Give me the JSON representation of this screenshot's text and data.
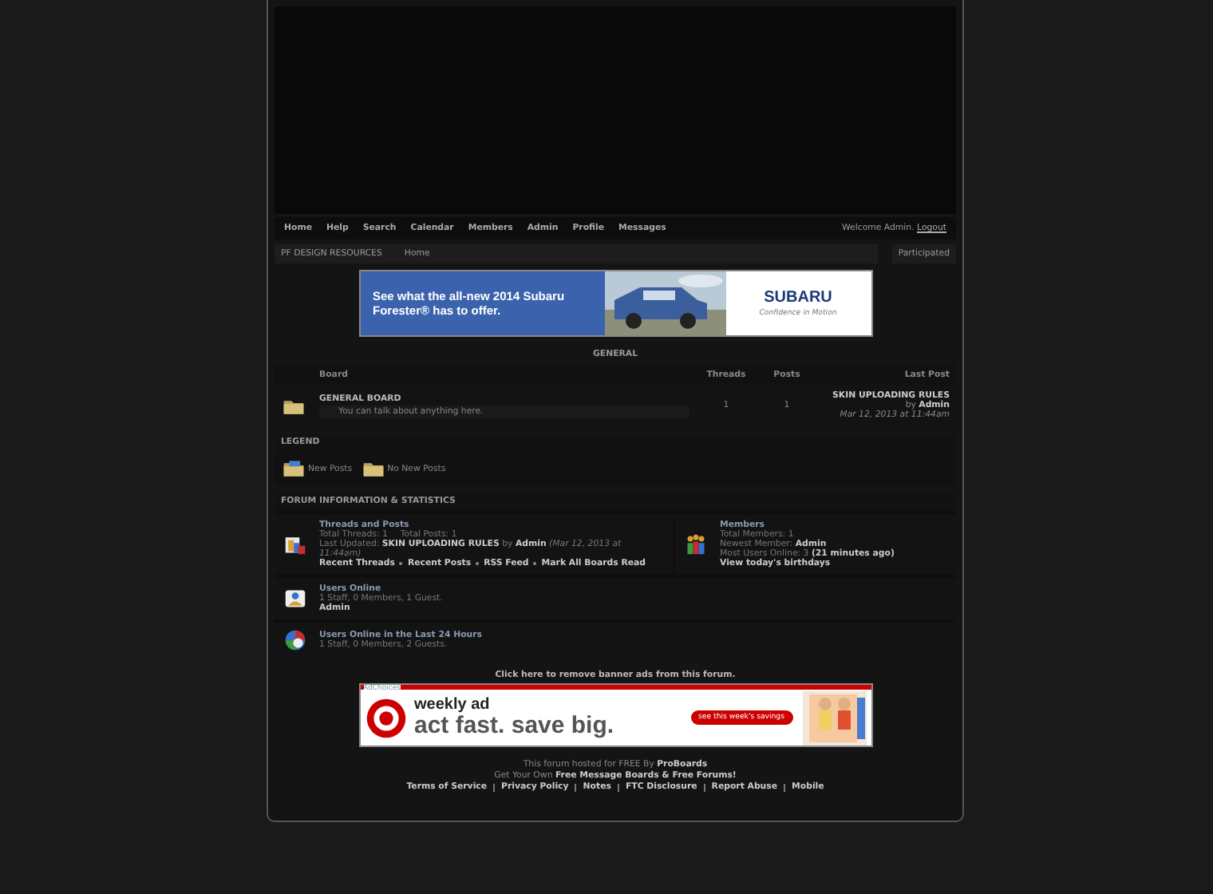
{
  "nav": {
    "items": [
      "Home",
      "Help",
      "Search",
      "Calendar",
      "Members",
      "Admin",
      "Profile",
      "Messages"
    ],
    "welcome": "Welcome Admin.",
    "logout": "Logout"
  },
  "breadcrumb": {
    "items": [
      "PF DESIGN RESOURCES",
      "Home"
    ],
    "right": "Participated"
  },
  "top_ad": {
    "headline": "See what the all-new 2014 Subaru Forester® has to offer.",
    "brand": "SUBARU",
    "tagline": "Confidence in Motion"
  },
  "category": {
    "title": "GENERAL",
    "columns": [
      "Board",
      "Threads",
      "Posts",
      "Last Post"
    ],
    "boards": [
      {
        "name": "GENERAL BOARD",
        "description": "You can talk about anything here.",
        "threads": "1",
        "posts": "1",
        "last_title": "SKIN UPLOADING RULES",
        "last_by": "by",
        "last_user": "Admin",
        "last_date": "Mar 12, 2013 at 11:44am",
        "new_posts": false
      }
    ]
  },
  "legend": {
    "title": "LEGEND",
    "items": [
      {
        "label": "New Posts",
        "new_posts": true
      },
      {
        "label": "No New Posts",
        "new_posts": false
      }
    ]
  },
  "stats": {
    "title": "FORUM INFORMATION & STATISTICS",
    "threads": {
      "title": "Threads and Posts",
      "totals": [
        "Total Threads: 1",
        "Total Posts: 1"
      ],
      "last_label": "Last Updated:",
      "last_title": "SKIN UPLOADING RULES",
      "last_by": "by",
      "last_user": "Admin",
      "last_date": "(Mar 12, 2013 at 11:44am)",
      "links": [
        "Recent Threads",
        "Recent Posts",
        "RSS Feed",
        "Mark All Boards Read"
      ]
    },
    "members": {
      "title": "Members",
      "total": "Total Members: 1",
      "newest_label": "Newest Member:",
      "newest": "Admin",
      "most_label": "Most Users Online: 3",
      "most_when": "(21 minutes ago)",
      "birthdays": "View today's birthdays"
    },
    "online": {
      "title": "Users Online",
      "summary": "1 Staff, 0 Members, 1 Guest.",
      "users": "Admin"
    },
    "online24": {
      "title": "Users Online in the Last 24 Hours",
      "summary": "1 Staff, 0 Members, 2 Guests."
    }
  },
  "remove_ads": "Click here to remove banner ads from this forum.",
  "bottom_ad": {
    "adchoices": "AdChoices",
    "line1": "weekly ad",
    "line2": "act fast. save big.",
    "button": "see this week's savings"
  },
  "footer": {
    "hosted": "This forum hosted for FREE By",
    "hosted_link": "ProBoards",
    "own": "Get Your Own",
    "own_link": "Free Message Boards & Free Forums!",
    "links": [
      "Terms of Service",
      "Privacy Policy",
      "Notes",
      "FTC Disclosure",
      "Report Abuse",
      "Mobile"
    ]
  }
}
